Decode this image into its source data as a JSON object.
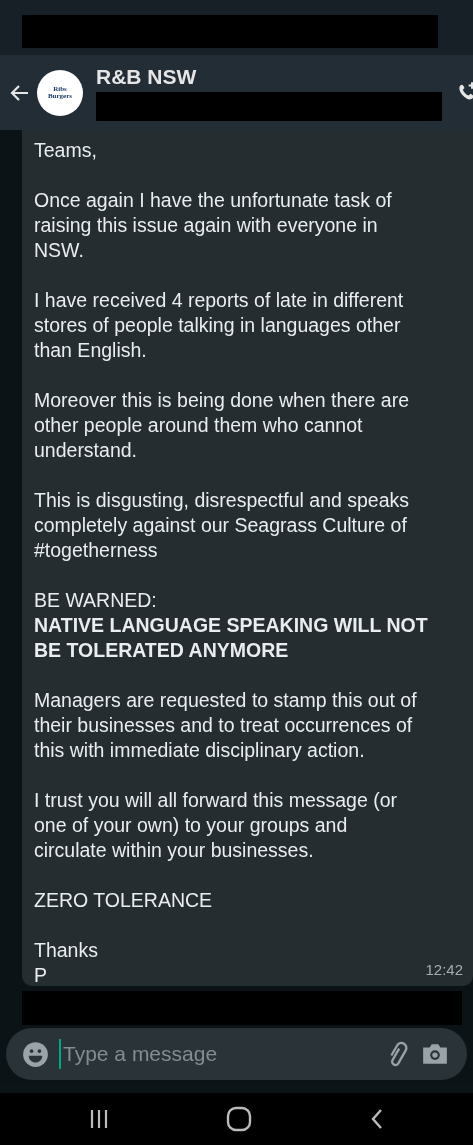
{
  "header": {
    "title": "R&B NSW",
    "avatar_logo": [
      "Ribs",
      "Burgers"
    ]
  },
  "message": {
    "paragraphs": [
      [
        "Teams,"
      ],
      [
        "Once again I have the unfortunate task of",
        "raising this issue again with everyone in",
        "NSW."
      ],
      [
        "I have received 4 reports of late in different",
        "stores of people talking in languages other",
        "than English."
      ],
      [
        "Moreover this is being done when there are",
        "other people around them who cannot",
        "understand."
      ],
      [
        "This is disgusting, disrespectful and speaks",
        "completely against our Seagrass Culture of",
        "#togetherness"
      ],
      [
        "BE WARNED:",
        "**NATIVE LANGUAGE SPEAKING WILL NOT**",
        "**BE TOLERATED ANYMORE**"
      ],
      [
        "Managers are requested to stamp this out of",
        "their businesses and to treat occurrences of",
        "this with immediate disciplinary action."
      ],
      [
        "I trust you will all forward this message (or",
        "one of your own) to your groups and",
        "circulate within your businesses."
      ],
      [
        "ZERO TOLERANCE"
      ],
      [
        "Thanks",
        "P"
      ]
    ],
    "time": "12:42"
  },
  "composer": {
    "placeholder": "Type a message"
  }
}
